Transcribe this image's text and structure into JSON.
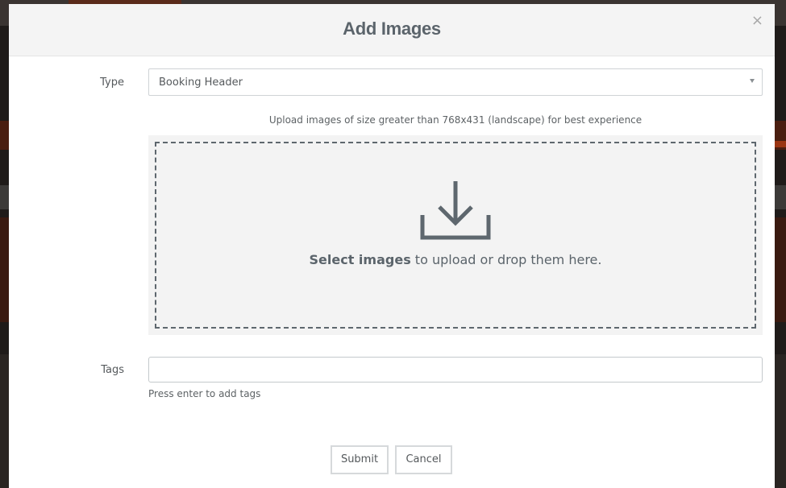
{
  "modal": {
    "title": "Add Images",
    "close_symbol": "×"
  },
  "form": {
    "type_label": "Type",
    "type_value": "Booking Header",
    "hint": "Upload images of size greater than 768x431 (landscape) for best experience",
    "dropzone": {
      "icon": "download-icon",
      "select_text": "Select images",
      "rest_text": " to upload or drop them here."
    },
    "tags_label": "Tags",
    "tags_value": "",
    "tags_help": "Press enter to add tags"
  },
  "actions": {
    "submit_label": "Submit",
    "cancel_label": "Cancel"
  },
  "colors": {
    "text": "#55595c",
    "title": "#5b646b",
    "dropzone_bg": "#f3f3f3",
    "dropzone_border": "#5e676e"
  }
}
